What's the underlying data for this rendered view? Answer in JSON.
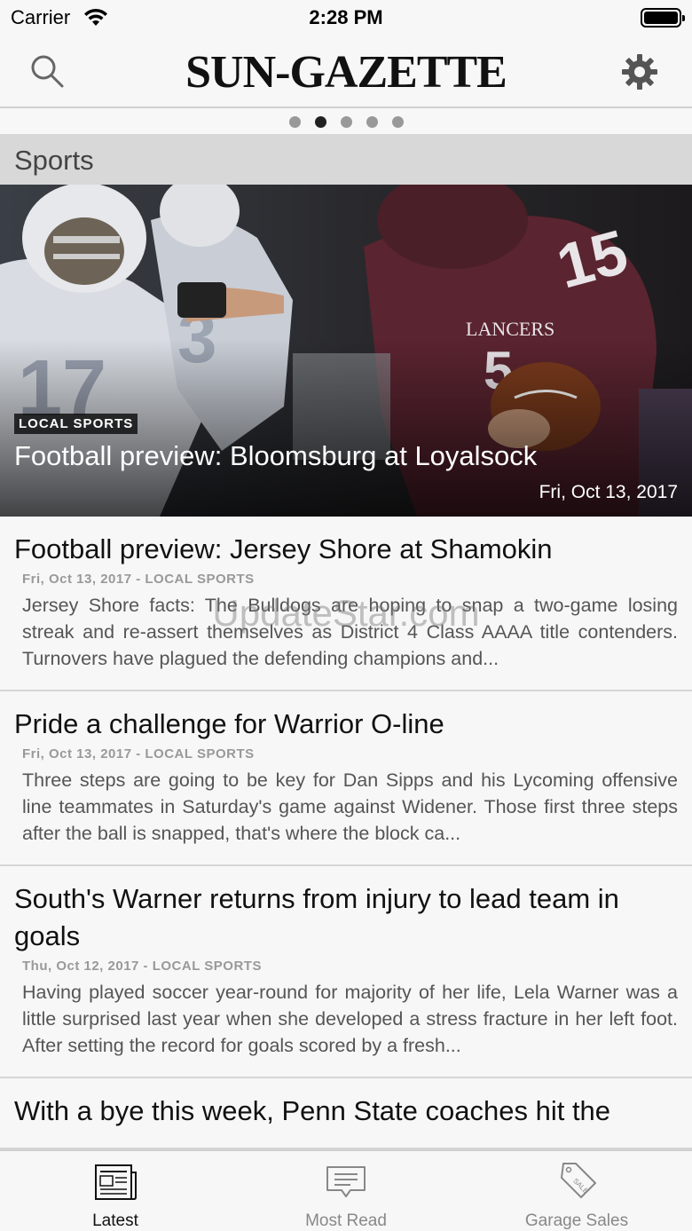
{
  "status_bar": {
    "carrier": "Carrier",
    "time": "2:28 PM"
  },
  "header": {
    "masthead": "SUN-GAZETTE",
    "search_icon": "search-icon",
    "settings_icon": "gear-icon"
  },
  "pager": {
    "count": 5,
    "active_index": 1
  },
  "section": {
    "title": "Sports"
  },
  "hero": {
    "category": "LOCAL SPORTS",
    "title": "Football preview: Bloomsburg at Loyalsock",
    "date": "Fri, Oct 13, 2017"
  },
  "articles": [
    {
      "title": "Football preview: Jersey Shore at Shamokin",
      "meta": "Fri, Oct 13, 2017 - LOCAL SPORTS",
      "summary": "Jersey Shore facts: The Bulldogs are hoping to snap a two-game losing streak and re-assert themselves as District 4 Class AAAA title contenders. Turnovers have plagued the defending champions and..."
    },
    {
      "title": "Pride a challenge for Warrior O-line",
      "meta": "Fri, Oct 13, 2017 - LOCAL SPORTS",
      "summary": "Three steps are going to be key for Dan Sipps and his Lycoming offensive line teammates in Saturday's game against Widener. Those first three steps after the ball is snapped, that's where the block ca..."
    },
    {
      "title": "South's Warner returns from injury to lead team in goals",
      "meta": "Thu, Oct 12, 2017 - LOCAL SPORTS",
      "summary": "Having played soccer year-round for majority of her life, Lela Warner was a little surprised last year when she developed a stress fracture in her left foot. After setting the record for goals scored by a fresh..."
    },
    {
      "title": "With a bye this week, Penn State coaches hit the",
      "meta": "",
      "summary": ""
    }
  ],
  "watermark": "UpdateStar.com",
  "tabs": [
    {
      "label": "Latest",
      "icon": "newspaper-icon",
      "active": true
    },
    {
      "label": "Most Read",
      "icon": "message-icon",
      "active": false
    },
    {
      "label": "Garage Sales",
      "icon": "sale-tag-icon",
      "active": false
    }
  ]
}
